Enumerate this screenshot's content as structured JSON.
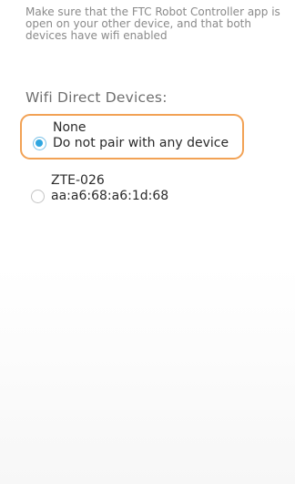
{
  "instructions": "Make sure that the FTC Robot Controller app is open on your other device, and that both devices have wifi enabled",
  "section_title": "Wifi Direct Devices:",
  "devices": [
    {
      "name": "None",
      "detail": "Do not pair with any device",
      "selected": true
    },
    {
      "name": "ZTE-026",
      "detail": "aa:a6:68:a6:1d:68",
      "selected": false
    }
  ],
  "colors": {
    "radio_selected": "#2fa6e0",
    "highlight_outline": "#f2a255"
  }
}
